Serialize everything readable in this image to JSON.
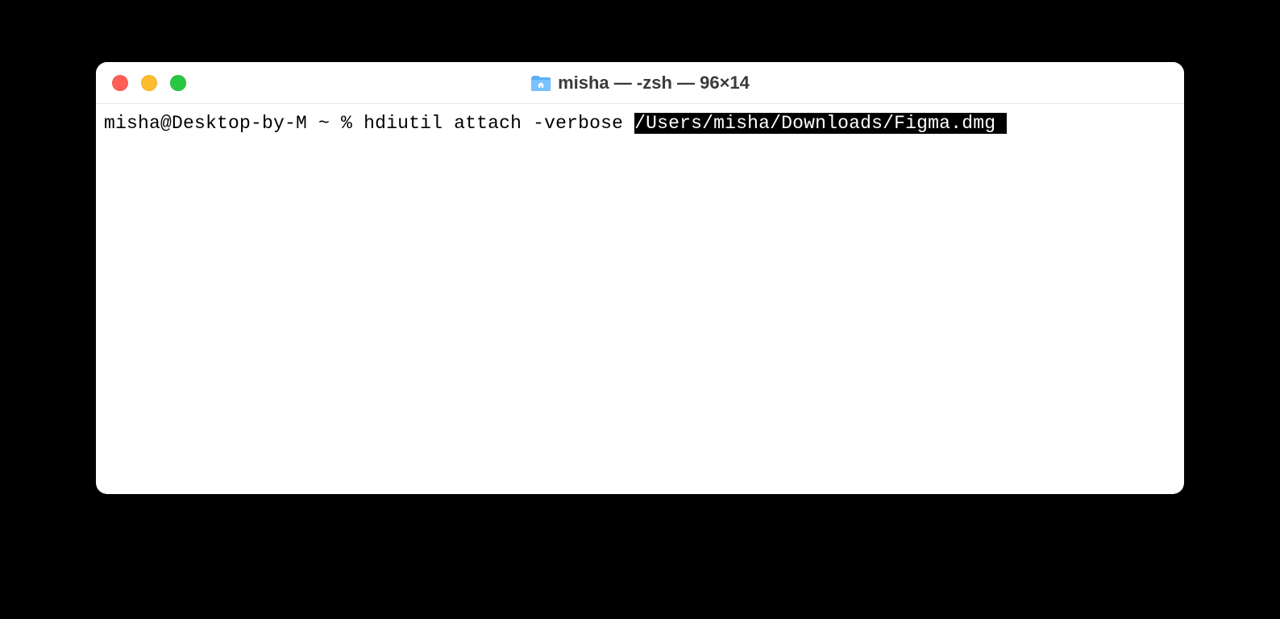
{
  "window": {
    "title": "misha — -zsh — 96×14",
    "icon_name": "home-folder-icon"
  },
  "terminal": {
    "prompt": "misha@Desktop-by-M ~ % ",
    "command_plain": "hdiutil attach -verbose ",
    "command_highlighted": "/Users/misha/Downloads/Figma.dmg "
  }
}
